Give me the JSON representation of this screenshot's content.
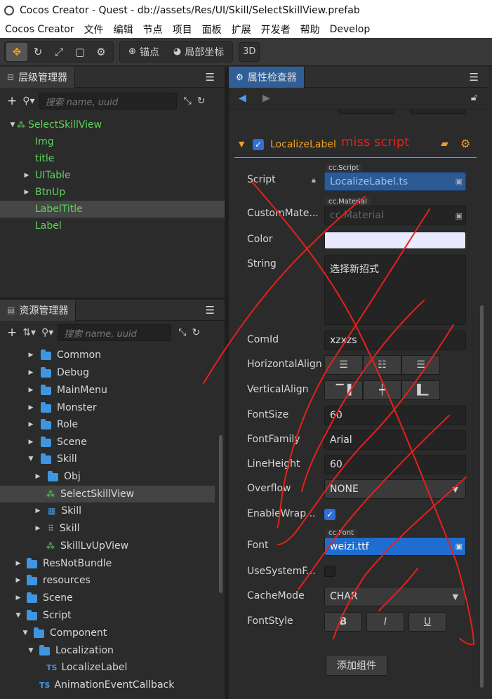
{
  "window": {
    "title": "Cocos Creator - Quest - db://assets/Res/UI/Skill/SelectSkillView.prefab",
    "menu": [
      "Cocos Creator",
      "文件",
      "编辑",
      "节点",
      "项目",
      "面板",
      "扩展",
      "开发者",
      "帮助",
      "Develop"
    ]
  },
  "toolbar": {
    "anchor_label": "锚点",
    "local_coord_label": "局部坐标",
    "mode_3d": "3D"
  },
  "hierarchy": {
    "title": "层级管理器",
    "search_placeholder": "搜索 name, uuid",
    "nodes": [
      {
        "label": "SelectSkillView"
      },
      {
        "label": "Img"
      },
      {
        "label": "title"
      },
      {
        "label": "UITable"
      },
      {
        "label": "BtnUp"
      },
      {
        "label": "LabelTitle"
      },
      {
        "label": "Label"
      }
    ]
  },
  "assets": {
    "title": "资源管理器",
    "search_placeholder": "搜索 name, uuid",
    "items": [
      {
        "label": "Common"
      },
      {
        "label": "Debug"
      },
      {
        "label": "MainMenu"
      },
      {
        "label": "Monster"
      },
      {
        "label": "Role"
      },
      {
        "label": "Scene"
      },
      {
        "label": "Skill"
      },
      {
        "label": "Obj"
      },
      {
        "label": "SelectSkillView"
      },
      {
        "label": "Skill"
      },
      {
        "label": "Skill"
      },
      {
        "label": "SkillLvUpView"
      },
      {
        "label": "ResNotBundle"
      },
      {
        "label": "resources"
      },
      {
        "label": "Scene"
      },
      {
        "label": "Script"
      },
      {
        "label": "Component"
      },
      {
        "label": "Localization"
      },
      {
        "label": "LocalizeLabel"
      },
      {
        "label": "AnimationEventCallback"
      }
    ]
  },
  "inspector": {
    "title": "属性检查器",
    "component_name": "LocalizeLabel",
    "missing_note": "miss script",
    "props": {
      "script_label": "Script",
      "script_tag": "cc.Script",
      "script_value": "LocalizeLabel.ts",
      "material_label": "CustomMate...",
      "material_tag": "cc.Material",
      "material_value": "cc.Material",
      "color_label": "Color",
      "string_label": "String",
      "string_value": "选择新招式",
      "comid_label": "ComId",
      "comid_value": "xzxzs",
      "halign_label": "HorizontalAlign",
      "valign_label": "VerticalAlign",
      "fontsize_label": "FontSize",
      "fontsize_value": "60",
      "fontfamily_label": "FontFamily",
      "fontfamily_value": "Arial",
      "lineheight_label": "LineHeight",
      "lineheight_value": "60",
      "overflow_label": "Overflow",
      "overflow_value": "NONE",
      "wrap_label": "EnableWrap...",
      "wrap_checked": true,
      "font_label": "Font",
      "font_tag": "cc.Font",
      "font_value": "weizi.ttf",
      "sysfont_label": "UseSystemF...",
      "sysfont_checked": false,
      "cachemode_label": "CacheMode",
      "cachemode_value": "CHAR",
      "fontstyle_label": "FontStyle",
      "bold": "B",
      "italic": "I",
      "underline": "U"
    },
    "add_component": "添加组件",
    "colors": {
      "annotation_red": "#e8201a",
      "accent_orange": "#f0a020",
      "node_green": "#5fd15f"
    }
  }
}
